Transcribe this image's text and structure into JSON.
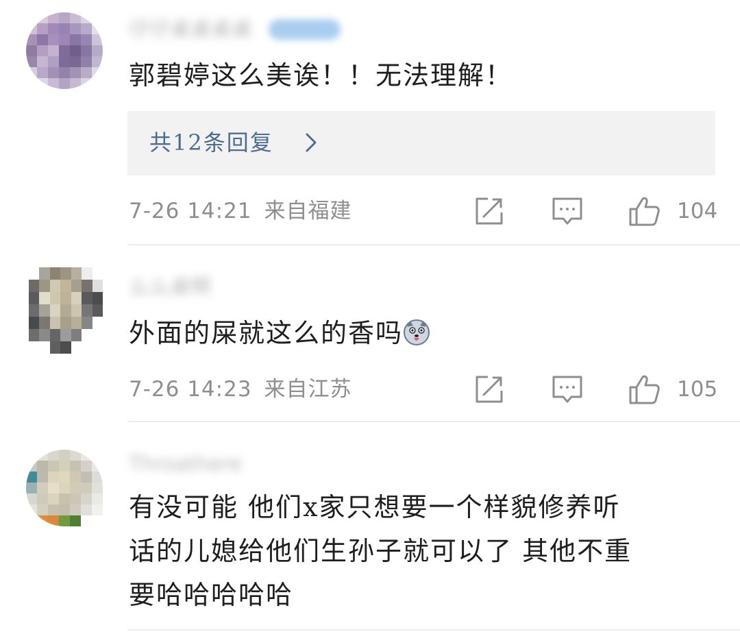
{
  "comments": [
    {
      "username": "仔仔桌桌桌桌",
      "text": "郭碧婷这么美诶！！无法理解！",
      "reply_label": "共12条回复",
      "time": "7-26 14:21",
      "location": "来自福建",
      "likes": "104",
      "avatar_icon": "avatar-1-pixelated-icon"
    },
    {
      "username": "么么桌啊",
      "text": "外面的屎就这么的香吗",
      "emoji": "dog-emoji-icon",
      "time": "7-26 14:23",
      "location": "来自江苏",
      "likes": "105"
    },
    {
      "username": "Throathere",
      "text_lines": [
        "有没可能  他们x家只想要一个样貌修养听",
        "话的儿媳给他们生孙子就可以了  其他不重",
        "要哈哈哈哈哈"
      ]
    }
  ],
  "colors": {
    "reply_link": "#4c6c91",
    "meta": "#8e8e8e",
    "reply_bg": "#f2f2f2",
    "divider": "#ececec"
  }
}
